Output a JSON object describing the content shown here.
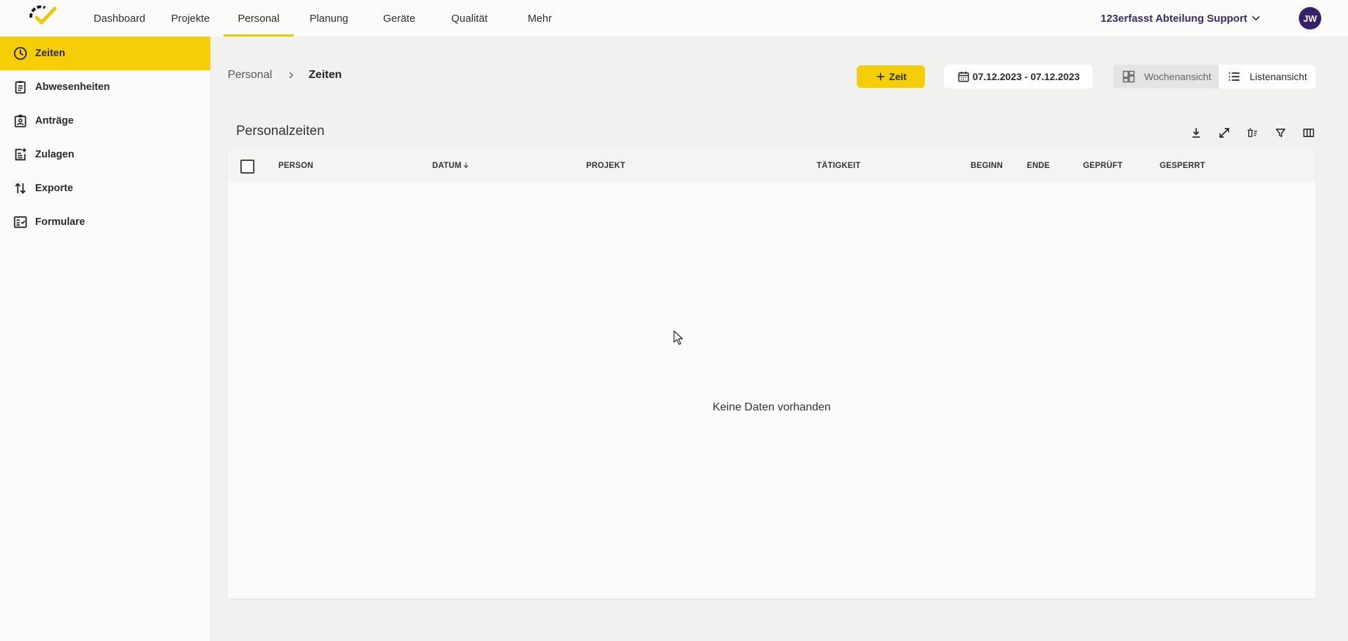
{
  "topnav": {
    "items": [
      {
        "label": "Dashboard",
        "active": false
      },
      {
        "label": "Projekte",
        "active": false
      },
      {
        "label": "Personal",
        "active": true
      },
      {
        "label": "Planung",
        "active": false
      },
      {
        "label": "Geräte",
        "active": false
      },
      {
        "label": "Qualität",
        "active": false
      },
      {
        "label": "Mehr",
        "active": false
      }
    ],
    "organization": "123erfasst Abteilung Support",
    "avatar_initials": "JW"
  },
  "sidebar": {
    "items": [
      {
        "label": "Zeiten",
        "icon": "clock-icon",
        "active": true
      },
      {
        "label": "Abwesenheiten",
        "icon": "clipboard-icon",
        "active": false
      },
      {
        "label": "Anträge",
        "icon": "badge-icon",
        "active": false
      },
      {
        "label": "Zulagen",
        "icon": "note-add-icon",
        "active": false
      },
      {
        "label": "Exporte",
        "icon": "swap-vertical-icon",
        "active": false
      },
      {
        "label": "Formulare",
        "icon": "form-checklist-icon",
        "active": false
      }
    ]
  },
  "breadcrumb": {
    "root": "Personal",
    "current": "Zeiten"
  },
  "toolbar": {
    "add_label": "Zeit",
    "date_range": "07.12.2023 - 07.12.2023",
    "view_week": "Wochenansicht",
    "view_list": "Listenansicht"
  },
  "table": {
    "title": "Personalzeiten",
    "columns": [
      "PERSON",
      "DATUM",
      "PROJEKT",
      "TÄTIGKEIT",
      "BEGINN",
      "ENDE",
      "GEPRÜFT",
      "GESPERRT"
    ],
    "sort_column": "DATUM",
    "sort_direction": "descending",
    "empty_text": "Keine Daten vorhanden"
  },
  "colors": {
    "accent": "#f6ce07",
    "avatar": "#35206a",
    "organization": "#3a2a6e"
  }
}
